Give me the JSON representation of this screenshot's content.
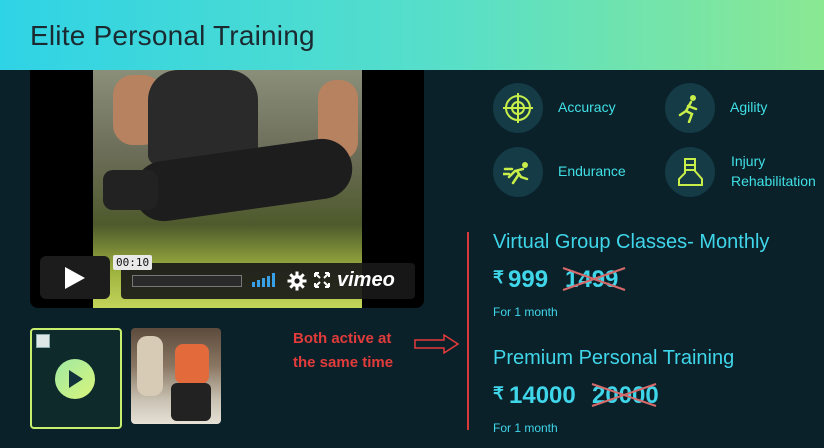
{
  "header": {
    "title": "Elite Personal Training"
  },
  "player": {
    "timecode": "00:10",
    "progress": 0.0,
    "brand": "vimeo",
    "icons": [
      "play-icon",
      "volume-bars-icon",
      "settings-gear-icon",
      "fullscreen-icon"
    ]
  },
  "thumbnails": [
    {
      "name": "video-thumbnail",
      "icon": "play-icon",
      "active": true
    },
    {
      "name": "photo-thumbnail",
      "active": false
    }
  ],
  "annotation": {
    "line1": "Both active at",
    "line2": "the same time",
    "arrow": "arrow-right-icon",
    "color": "#e23b3b"
  },
  "features": [
    {
      "label": "Accuracy",
      "icon": "target-icon"
    },
    {
      "label": "Agility",
      "icon": "running-figure-icon"
    },
    {
      "label": "Endurance",
      "icon": "sprinter-icon"
    },
    {
      "label_line1": "Injury",
      "label_line2": "Rehabilitation",
      "icon": "ankle-brace-icon"
    }
  ],
  "plans": [
    {
      "title": "Virtual Group Classes- Monthly",
      "currency": "₹",
      "price": "999",
      "old_price": "1499",
      "duration": "For 1 month"
    },
    {
      "title": "Premium Personal Training",
      "currency": "₹",
      "price": "14000",
      "old_price": "20000",
      "duration": "For 1 month"
    }
  ],
  "colors": {
    "background": "#0b2129",
    "accent": "#3fd6ea",
    "highlight": "#c8ee6d",
    "strike": "#d66a6a"
  }
}
